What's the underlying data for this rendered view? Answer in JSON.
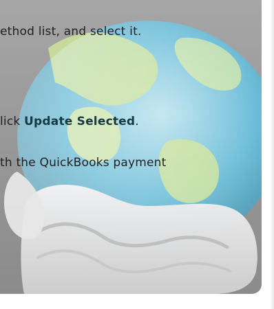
{
  "instructions": {
    "line1": "ethod list, and select it.",
    "line2_prefix": "lick ",
    "line2_bold": "Update Selected",
    "line2_suffix": ".",
    "line3": "th the QuickBooks payment"
  },
  "colors": {
    "overlay_gray": "#999999",
    "globe_blue": "#56b7d6",
    "globe_green": "#cfe39a",
    "bold_text": "#163a45"
  },
  "icons": [
    "globe-icon",
    "hand-icon"
  ]
}
